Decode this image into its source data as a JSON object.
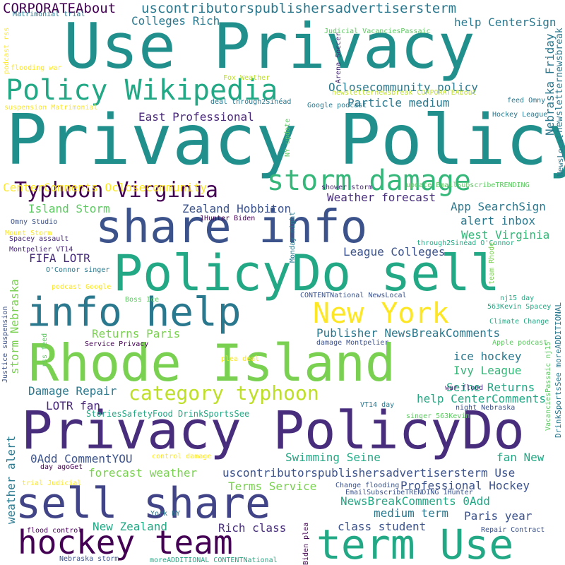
{
  "colors": {
    "dark_purple": "#440154",
    "indigo": "#472d7b",
    "slate_blue": "#3b528b",
    "steel_blue": "#2c728e",
    "teal": "#21908d",
    "sea_green": "#27ad81",
    "green": "#5cc863",
    "lime": "#aadc32",
    "yellow": "#fde725"
  },
  "words": [
    {
      "text": "Use Privacy",
      "color": "#21908d"
    },
    {
      "text": "Privacy Policy",
      "color": "#21908d"
    },
    {
      "text": "Rhode Island",
      "color": "#7ad151"
    },
    {
      "text": "Privacy PolicyDo",
      "color": "#472d7b"
    },
    {
      "text": "PolicyDo sell",
      "color": "#22a884"
    },
    {
      "text": "share info",
      "color": "#3b528b"
    },
    {
      "text": "info help",
      "color": "#2a788e"
    },
    {
      "text": "sell share",
      "color": "#414487"
    },
    {
      "text": "term Use",
      "color": "#22a884"
    },
    {
      "text": "hockey team",
      "color": "#440154"
    },
    {
      "text": "Policy Wikipedia",
      "color": "#22a884"
    },
    {
      "text": "New York",
      "color": "#fde725"
    },
    {
      "text": "storm damage",
      "color": "#35b779"
    },
    {
      "text": "Typhoon Virginia",
      "color": "#440154"
    },
    {
      "text": "category typhoon",
      "color": "#bddf26"
    },
    {
      "text": "CORPORATEAbout",
      "color": "#440154"
    },
    {
      "text": "uscontributorspublishersadvertisersterm",
      "color": "#2a788e"
    },
    {
      "text": "Colleges Rich",
      "color": "#2a788e"
    },
    {
      "text": "help CenterSign",
      "color": "#2a788e"
    },
    {
      "text": "Oclosecommunity policy",
      "color": "#2a788e"
    },
    {
      "text": "Particle medium",
      "color": "#2a788e"
    },
    {
      "text": "East Professional",
      "color": "#482878"
    },
    {
      "text": "CenterComments Oclosecommunity",
      "color": "#fde725"
    },
    {
      "text": "Weather forecast",
      "color": "#472d7b"
    },
    {
      "text": "Island Storm",
      "color": "#5ec962"
    },
    {
      "text": "Zealand Hobbiton",
      "color": "#3b528b"
    },
    {
      "text": "App SearchSign",
      "color": "#2a788e"
    },
    {
      "text": "alert inbox",
      "color": "#2a788e"
    },
    {
      "text": "West Virginia",
      "color": "#35b779"
    },
    {
      "text": "League Colleges",
      "color": "#3b528b"
    },
    {
      "text": "FIFA LOTR",
      "color": "#472d7b"
    },
    {
      "text": "Returns Paris",
      "color": "#7ad151"
    },
    {
      "text": "Publisher NewsBreakComments",
      "color": "#2a788e"
    },
    {
      "text": "ice hockey",
      "color": "#2a788e"
    },
    {
      "text": "Ivy League",
      "color": "#35b779"
    },
    {
      "text": "Damage Repair",
      "color": "#2a788e"
    },
    {
      "text": "Seine Returns",
      "color": "#22a884"
    },
    {
      "text": "help CenterComments",
      "color": "#22a884"
    },
    {
      "text": "LOTR fan",
      "color": "#482878"
    },
    {
      "text": "StoriesSafetyFood DrinkSportsSee",
      "color": "#22a884"
    },
    {
      "text": "Swimming Seine",
      "color": "#22a884"
    },
    {
      "text": "0Add CommentYOU",
      "color": "#3b528b"
    },
    {
      "text": "fan New",
      "color": "#22a884"
    },
    {
      "text": "forecast weather",
      "color": "#7ad151"
    },
    {
      "text": "uscontributorspublishersadvertisersterm Use",
      "color": "#3b528b"
    },
    {
      "text": "Terms Service",
      "color": "#7ad151"
    },
    {
      "text": "Professional Hockey",
      "color": "#3b528b"
    },
    {
      "text": "NewsBreakComments 0Add",
      "color": "#22a884"
    },
    {
      "text": "medium term",
      "color": "#2a788e"
    },
    {
      "text": "Paris year",
      "color": "#3b528b"
    },
    {
      "text": "New Zealand",
      "color": "#22a884"
    },
    {
      "text": "Rich class",
      "color": "#472d7b"
    },
    {
      "text": "class student",
      "color": "#3b528b"
    },
    {
      "text": "weather alert",
      "color": "#2a788e"
    },
    {
      "text": "storm Nebraska",
      "color": "#7ad151"
    },
    {
      "text": "Nebraska Friday",
      "color": "#2a788e"
    },
    {
      "text": "newsletternewsbreak",
      "color": "#2a788e"
    },
    {
      "text": "NewsLocal",
      "color": "#2a788e"
    },
    {
      "text": "Matrimonial trial",
      "color": "#2a788e"
    },
    {
      "text": "podcast rss",
      "color": "#fde725"
    },
    {
      "text": "flooding war",
      "color": "#fde725"
    },
    {
      "text": "suspension Matrimonial",
      "color": "#fde725"
    },
    {
      "text": "Judicial VacanciesPassaic",
      "color": "#5ec962"
    },
    {
      "text": "Arena Soccer",
      "color": "#482878"
    },
    {
      "text": "newsletternewsbreak CORPORATEAbout",
      "color": "#bddf26"
    },
    {
      "text": "Fox Weather",
      "color": "#bddf26"
    },
    {
      "text": "deal through2Sinéad",
      "color": "#2a788e"
    },
    {
      "text": "Google podcast",
      "color": "#2a788e"
    },
    {
      "text": "feed Omny",
      "color": "#2a788e"
    },
    {
      "text": "Hockey League",
      "color": "#2a788e"
    },
    {
      "text": "NY update",
      "color": "#5ec962"
    },
    {
      "text": "update EmailSubscribeTRENDING",
      "color": "#5ec962"
    },
    {
      "text": "shower storm",
      "color": "#482878"
    },
    {
      "text": "1Hunter Biden",
      "color": "#440154"
    },
    {
      "text": "Omny Studio",
      "color": "#3b528b"
    },
    {
      "text": "Mount Storm",
      "color": "#fde725"
    },
    {
      "text": "Spacey assault",
      "color": "#482878"
    },
    {
      "text": "Montpelier VT14",
      "color": "#482878"
    },
    {
      "text": "Monday night",
      "color": "#2a788e"
    },
    {
      "text": "through2Sinéad O'Connor",
      "color": "#22a884"
    },
    {
      "text": "O'Connor singer",
      "color": "#2a788e"
    },
    {
      "text": "podcast Google",
      "color": "#fde725"
    },
    {
      "text": "team Rhode",
      "color": "#7ad151"
    },
    {
      "text": "Boss Ice",
      "color": "#5ec962"
    },
    {
      "text": "CONTENTNational NewsLocal",
      "color": "#3b528b"
    },
    {
      "text": "nj15 day",
      "color": "#22a884"
    },
    {
      "text": "563Kevin Spacey",
      "color": "#22a884"
    },
    {
      "text": "Climate Change",
      "color": "#22a884"
    },
    {
      "text": "rss feed",
      "color": "#5ec962"
    },
    {
      "text": "damage Montpelier",
      "color": "#3b528b"
    },
    {
      "text": "Service Privacy",
      "color": "#440154"
    },
    {
      "text": "Apple podcast",
      "color": "#5ec962"
    },
    {
      "text": "Justice suspension",
      "color": "#3b528b"
    },
    {
      "text": "plea deal",
      "color": "#fde725"
    },
    {
      "text": "VacanciesPassaic nj15",
      "color": "#5ec962"
    },
    {
      "text": "DrinkSportsSee moreADDITIONAL",
      "color": "#2a788e"
    },
    {
      "text": "war flood",
      "color": "#482878"
    },
    {
      "text": "night Nebraska",
      "color": "#3b528b"
    },
    {
      "text": "VT14 day",
      "color": "#2a788e"
    },
    {
      "text": "singer 563Kevin",
      "color": "#5ec962"
    },
    {
      "text": "control damage",
      "color": "#fde725"
    },
    {
      "text": "day agoGet",
      "color": "#440154"
    },
    {
      "text": "trial Judicial",
      "color": "#fde725"
    },
    {
      "text": "Change flooding",
      "color": "#3b528b"
    },
    {
      "text": "EmailSubscribeTRENDING 1Hunter",
      "color": "#3b528b"
    },
    {
      "text": "York NY",
      "color": "#2a788e"
    },
    {
      "text": "Repair Contract",
      "color": "#3b528b"
    },
    {
      "text": "flood control",
      "color": "#440154"
    },
    {
      "text": "Nebraska storm",
      "color": "#3b528b"
    },
    {
      "text": "moreADDITIONAL CONTENTNational",
      "color": "#22a884"
    },
    {
      "text": "Biden plea",
      "color": "#440154"
    }
  ]
}
